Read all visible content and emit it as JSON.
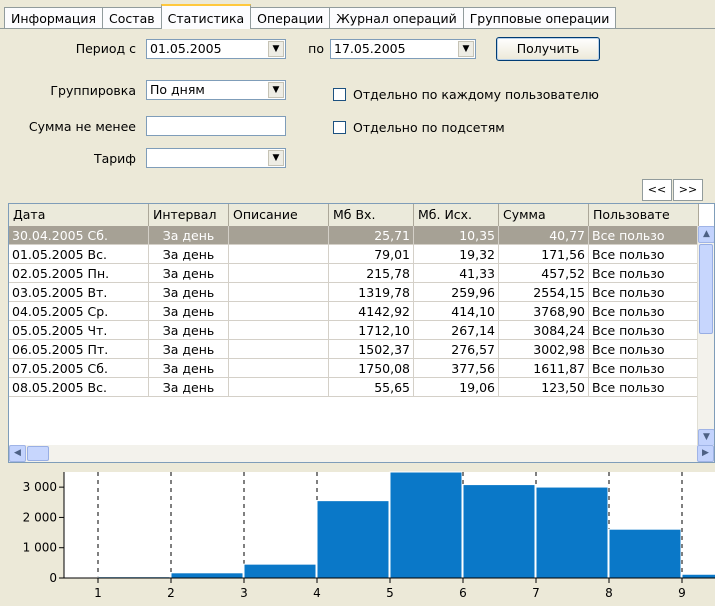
{
  "tabs": [
    {
      "label": "Информация",
      "active": false
    },
    {
      "label": "Состав",
      "active": false
    },
    {
      "label": "Статистика",
      "active": true
    },
    {
      "label": "Операции",
      "active": false
    },
    {
      "label": "Журнал операций",
      "active": false
    },
    {
      "label": "Групповые операции",
      "active": false
    }
  ],
  "form": {
    "period_from_label": "Период с",
    "period_from_value": "01.05.2005",
    "period_to_label": "по",
    "period_to_value": "17.05.2005",
    "get_button": "Получить",
    "grouping_label": "Группировка",
    "grouping_value": "По дням",
    "sum_label": "Сумма не менее",
    "sum_value": "",
    "tariff_label": "Тариф",
    "tariff_value": "",
    "per_user_label": "Отдельно по каждому пользователю",
    "per_user_checked": false,
    "per_subnet_label": "Отдельно по подсетям",
    "per_subnet_checked": false,
    "prev_button": "<<",
    "next_button": ">>"
  },
  "table": {
    "headers": [
      "Дата",
      "Интервал",
      "Описание",
      "Мб Вх.",
      "Мб. Исх.",
      "Сумма",
      "Пользовате"
    ],
    "rows": [
      {
        "date": "30.04.2005 Сб.",
        "interval": "За день",
        "description": "",
        "mb_in": "25,71",
        "mb_out": "10,35",
        "sum": "40,77",
        "user": "Все пользо",
        "selected": true
      },
      {
        "date": "01.05.2005 Вс.",
        "interval": "За день",
        "description": "",
        "mb_in": "79,01",
        "mb_out": "19,32",
        "sum": "171,56",
        "user": "Все пользо",
        "selected": false
      },
      {
        "date": "02.05.2005 Пн.",
        "interval": "За день",
        "description": "",
        "mb_in": "215,78",
        "mb_out": "41,33",
        "sum": "457,52",
        "user": "Все пользо",
        "selected": false
      },
      {
        "date": "03.05.2005 Вт.",
        "interval": "За день",
        "description": "",
        "mb_in": "1319,78",
        "mb_out": "259,96",
        "sum": "2554,15",
        "user": "Все пользо",
        "selected": false
      },
      {
        "date": "04.05.2005 Ср.",
        "interval": "За день",
        "description": "",
        "mb_in": "4142,92",
        "mb_out": "414,10",
        "sum": "3768,90",
        "user": "Все пользо",
        "selected": false
      },
      {
        "date": "05.05.2005 Чт.",
        "interval": "За день",
        "description": "",
        "mb_in": "1712,10",
        "mb_out": "267,14",
        "sum": "3084,24",
        "user": "Все пользо",
        "selected": false
      },
      {
        "date": "06.05.2005 Пт.",
        "interval": "За день",
        "description": "",
        "mb_in": "1502,37",
        "mb_out": "276,57",
        "sum": "3002,98",
        "user": "Все пользо",
        "selected": false
      },
      {
        "date": "07.05.2005 Сб.",
        "interval": "За день",
        "description": "",
        "mb_in": "1750,08",
        "mb_out": "377,56",
        "sum": "1611,87",
        "user": "Все пользо",
        "selected": false
      },
      {
        "date": "08.05.2005 Вс.",
        "interval": "За день",
        "description": "",
        "mb_in": "55,65",
        "mb_out": "19,06",
        "sum": "123,50",
        "user": "Все пользо",
        "selected": false
      }
    ]
  },
  "icons": {
    "combo_arrow": "chevron-down-icon",
    "scroll_up": "arrow-up-icon",
    "scroll_down": "arrow-down-icon",
    "scroll_left": "arrow-left-icon",
    "scroll_right": "arrow-right-icon"
  },
  "colors": {
    "bar": "#0a78c8",
    "selected_row": "#a6a195",
    "window_bg": "#ece9d8",
    "tab_highlight": "#ffc83c"
  },
  "chart_data": {
    "type": "bar",
    "x": [
      1,
      2,
      3,
      4,
      5,
      6,
      7,
      8,
      9
    ],
    "xticks": [
      "1",
      "2",
      "3",
      "4",
      "5",
      "6",
      "7",
      "8",
      "9"
    ],
    "yticks": [
      "0",
      "1 000",
      "2 000",
      "3 000"
    ],
    "values": [
      40.77,
      171.56,
      457.52,
      2554.15,
      3768.9,
      3084.24,
      3002.98,
      1611.87,
      123.5
    ],
    "ylim": [
      0,
      3500
    ],
    "grid": "vertical dashed",
    "title": "",
    "xlabel": "",
    "ylabel": ""
  }
}
